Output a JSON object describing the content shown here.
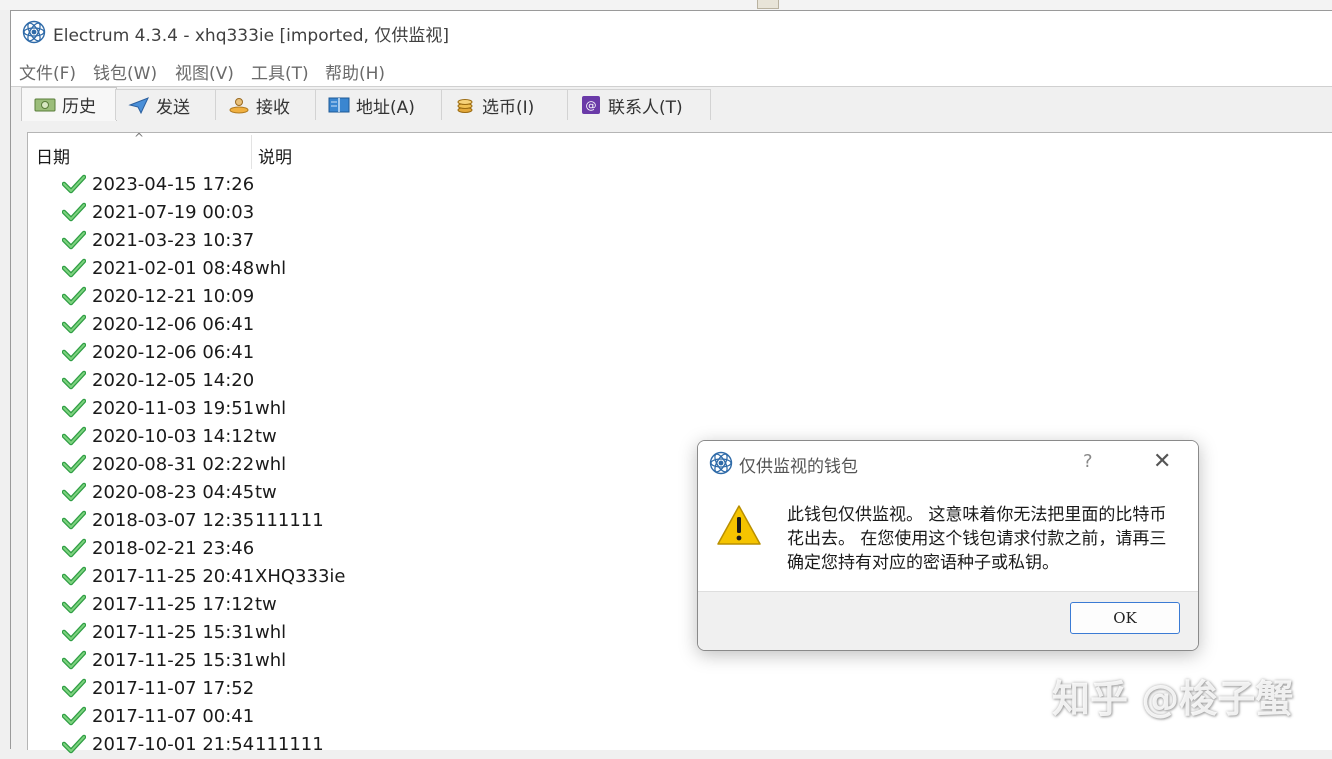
{
  "window": {
    "title": "Electrum 4.3.4  -  xhq333ie  [imported, 仅供监视]"
  },
  "menu": [
    {
      "label": "文件(F)"
    },
    {
      "label": "钱包(W)"
    },
    {
      "label": "视图(V)"
    },
    {
      "label": "工具(T)"
    },
    {
      "label": "帮助(H)"
    }
  ],
  "tabs": [
    {
      "label": "历史",
      "icon": "history-icon",
      "active": true
    },
    {
      "label": "发送",
      "icon": "send-icon"
    },
    {
      "label": "接收",
      "icon": "receive-icon"
    },
    {
      "label": "地址(A)",
      "icon": "addresses-icon"
    },
    {
      "label": "选币(I)",
      "icon": "coins-icon"
    },
    {
      "label": "联系人(T)",
      "icon": "contacts-icon"
    }
  ],
  "history": {
    "columns": [
      "日期",
      "说明"
    ],
    "sort_indicator": "^",
    "rows": [
      {
        "date": "2023-04-15 17:26",
        "desc": ""
      },
      {
        "date": "2021-07-19 00:03",
        "desc": ""
      },
      {
        "date": "2021-03-23 10:37",
        "desc": ""
      },
      {
        "date": "2021-02-01 08:48",
        "desc": "whl"
      },
      {
        "date": "2020-12-21 10:09",
        "desc": ""
      },
      {
        "date": "2020-12-06 06:41",
        "desc": ""
      },
      {
        "date": "2020-12-06 06:41",
        "desc": ""
      },
      {
        "date": "2020-12-05 14:20",
        "desc": ""
      },
      {
        "date": "2020-11-03 19:51",
        "desc": "whl"
      },
      {
        "date": "2020-10-03 14:12",
        "desc": "tw"
      },
      {
        "date": "2020-08-31 02:22",
        "desc": "whl"
      },
      {
        "date": "2020-08-23 04:45",
        "desc": "tw"
      },
      {
        "date": "2018-03-07 12:35",
        "desc": "111111"
      },
      {
        "date": "2018-02-21 23:46",
        "desc": ""
      },
      {
        "date": "2017-11-25 20:41",
        "desc": "XHQ333ie"
      },
      {
        "date": "2017-11-25 17:12",
        "desc": "tw"
      },
      {
        "date": "2017-11-25 15:31",
        "desc": "whl"
      },
      {
        "date": "2017-11-25 15:31",
        "desc": "whl"
      },
      {
        "date": "2017-11-07 17:52",
        "desc": ""
      },
      {
        "date": "2017-11-07 00:41",
        "desc": ""
      },
      {
        "date": "2017-10-01 21:54",
        "desc": "111111"
      }
    ]
  },
  "dialog": {
    "title": "仅供监视的钱包",
    "help": "?",
    "close": "✕",
    "message": "此钱包仅供监视。 这意味着你无法把里面的比特币花出去。 在您使用这个钱包请求付款之前，请再三确定您持有对应的密语种子或私钥。",
    "ok_label": "OK"
  },
  "watermark": "知乎 @梭子蟹",
  "colors": {
    "accent": "#3b7bd4",
    "check_green": "#3cb371",
    "warn_yellow": "#f5c400"
  }
}
